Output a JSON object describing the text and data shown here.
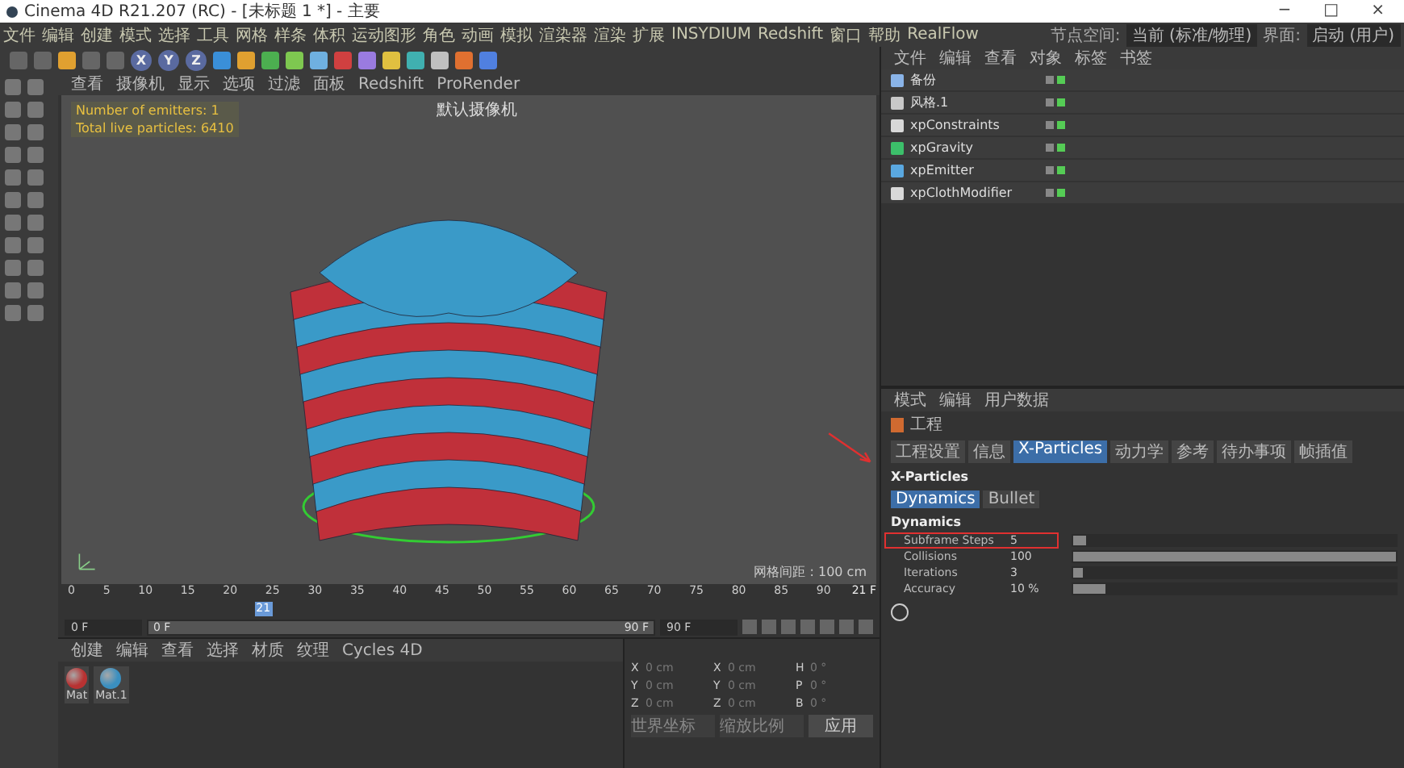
{
  "window": {
    "title": "Cinema 4D R21.207 (RC) - [未标题 1 *] - 主要",
    "controls": [
      "−",
      "□",
      "×"
    ]
  },
  "menu": [
    "文件",
    "编辑",
    "创建",
    "模式",
    "选择",
    "工具",
    "网格",
    "样条",
    "体积",
    "运动图形",
    "角色",
    "动画",
    "模拟",
    "渲染器",
    "渲染",
    "扩展",
    "INSYDIUM",
    "Redshift",
    "窗口",
    "帮助",
    "RealFlow"
  ],
  "layout": {
    "node_label": "节点空间:",
    "node_value": "当前 (标准/物理)",
    "ui_label": "界面:",
    "ui_value": "启动 (用户)"
  },
  "toolbar": {
    "axes": [
      "X",
      "Y",
      "Z"
    ]
  },
  "viewport": {
    "menu": [
      "查看",
      "摄像机",
      "显示",
      "选项",
      "过滤",
      "面板",
      "Redshift",
      "ProRender"
    ],
    "hud": [
      "Number of emitters: 1",
      "Total live particles: 6410"
    ],
    "camera": "默认摄像机",
    "grid": "网格间距 : 100 cm"
  },
  "timeline": {
    "ticks": [
      "0",
      "5",
      "10",
      "15",
      "20",
      "25",
      "30",
      "35",
      "40",
      "45",
      "50",
      "55",
      "60",
      "65",
      "70",
      "75",
      "80",
      "85",
      "90"
    ],
    "current": "21",
    "current_label": "21 F",
    "playhead": {
      "level": 0.233
    },
    "start": "0 F",
    "range_start": "0 F",
    "range_end": "90 F",
    "range": {
      "level": 1
    },
    "end": "90 F"
  },
  "materials": {
    "menu": [
      "创建",
      "编辑",
      "查看",
      "选择",
      "材质",
      "纹理",
      "Cycles 4D"
    ],
    "items": [
      {
        "name": "Mat",
        "color": "#b83232"
      },
      {
        "name": "Mat.1",
        "color": "#3a8fc0"
      }
    ]
  },
  "coordinates": {
    "rows": [
      {
        "a": "X",
        "p": "0 cm",
        "b": "X",
        "s": "0 cm",
        "c": "H",
        "r": "0 °"
      },
      {
        "a": "Y",
        "p": "0 cm",
        "b": "Y",
        "s": "0 cm",
        "c": "P",
        "r": "0 °"
      },
      {
        "a": "Z",
        "p": "0 cm",
        "b": "Z",
        "s": "0 cm",
        "c": "B",
        "r": "0 °"
      }
    ],
    "dropdowns": [
      "世界坐标",
      "缩放比例"
    ],
    "apply": "应用"
  },
  "objects": {
    "menu": [
      "文件",
      "编辑",
      "查看",
      "对象",
      "标签",
      "书签"
    ],
    "items": [
      {
        "name": "备份",
        "kind": "null"
      },
      {
        "name": "风格.1",
        "kind": "figure"
      },
      {
        "name": "xpConstraints",
        "kind": "xp"
      },
      {
        "name": "xpGravity",
        "kind": "modifier"
      },
      {
        "name": "xpEmitter",
        "kind": "emitter"
      },
      {
        "name": "xpClothModifier",
        "kind": "xp"
      }
    ]
  },
  "attributes": {
    "menu": [
      "模式",
      "编辑",
      "用户数据"
    ],
    "object": "工程",
    "tabs": [
      {
        "label": "工程设置",
        "selected": false
      },
      {
        "label": "信息",
        "selected": false
      },
      {
        "label": "X-Particles",
        "selected": true
      },
      {
        "label": "动力学",
        "selected": false
      },
      {
        "label": "参考",
        "selected": false
      },
      {
        "label": "待办事项",
        "selected": false
      },
      {
        "label": "帧插值",
        "selected": false
      }
    ],
    "group": "X-Particles",
    "subtabs": [
      {
        "label": "Dynamics",
        "selected": true
      },
      {
        "label": "Bullet",
        "selected": false
      }
    ],
    "section": "Dynamics",
    "params": [
      {
        "name": "Subframe Steps",
        "value": "5",
        "level": 0.04,
        "highlighted": true
      },
      {
        "name": "Collisions",
        "value": "100",
        "level": 1,
        "highlighted": false
      },
      {
        "name": "Iterations",
        "value": "3",
        "level": 0.015,
        "highlighted": false
      },
      {
        "name": "Accuracy",
        "value": "10 %",
        "level": 0.1,
        "highlighted": false
      }
    ]
  }
}
